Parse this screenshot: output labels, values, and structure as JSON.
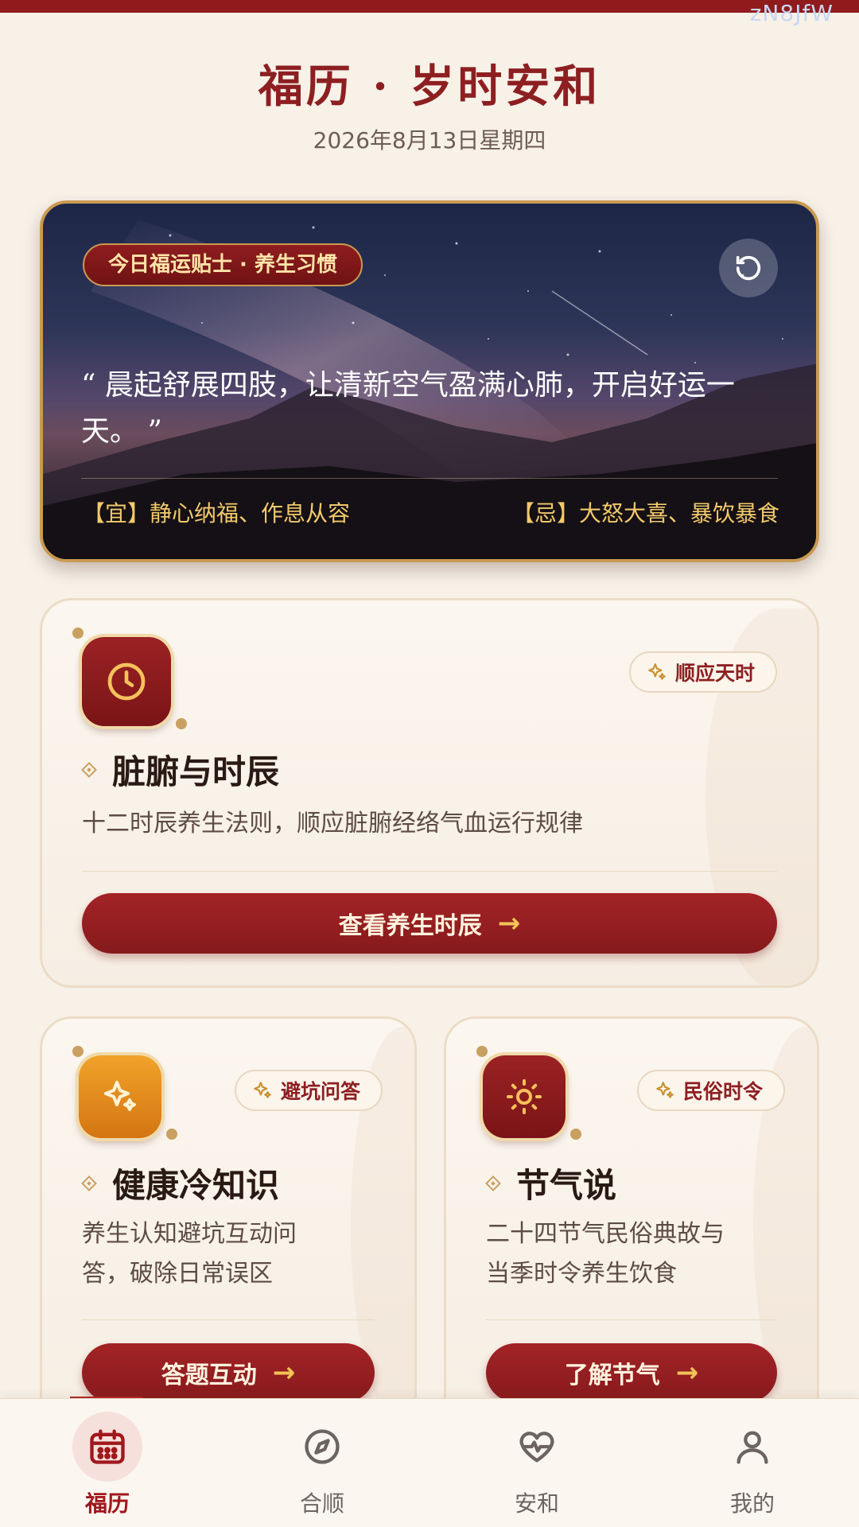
{
  "watermark": "zN8JfW",
  "header": {
    "title": "福历 · 岁时安和",
    "date": "2026年8月13日星期四"
  },
  "hero": {
    "badge": "今日福运贴士 · 养生习惯",
    "quote": "“ 晨起舒展四肢，让清新空气盈满心肺，开启好运一天。 ”",
    "yi": "【宜】静心纳福、作息从容",
    "ji": "【忌】大怒大喜、暴饮暴食",
    "refresh_icon": "refresh-icon"
  },
  "cards": {
    "zangfu": {
      "tag": "顺应天时",
      "title": "脏腑与时辰",
      "desc": "十二时辰养生法则，顺应脏腑经络气血运行规律",
      "button": "查看养生时辰",
      "icon": "clock-icon"
    },
    "health": {
      "tag": "避坑问答",
      "title": "健康冷知识",
      "desc_line1": "养生认知避坑互动问",
      "desc_line2": "答，破除日常误区",
      "button": "答题互动",
      "icon": "sparkle-icon"
    },
    "solar": {
      "tag": "民俗时令",
      "title": "节气说",
      "desc_line1": "二十四节气民俗典故与",
      "desc_line2": "当季时令养生饮食",
      "button": "了解节气",
      "icon": "sun-icon"
    }
  },
  "nav": [
    {
      "label": "福历",
      "icon": "calendar-icon",
      "active": true
    },
    {
      "label": "合顺",
      "icon": "compass-icon",
      "active": false
    },
    {
      "label": "安和",
      "icon": "heartbeat-icon",
      "active": false
    },
    {
      "label": "我的",
      "icon": "user-icon",
      "active": false
    }
  ],
  "colors": {
    "primary_red": "#8d1f21",
    "gold": "#c99a52",
    "background": "#f7f1e8"
  }
}
